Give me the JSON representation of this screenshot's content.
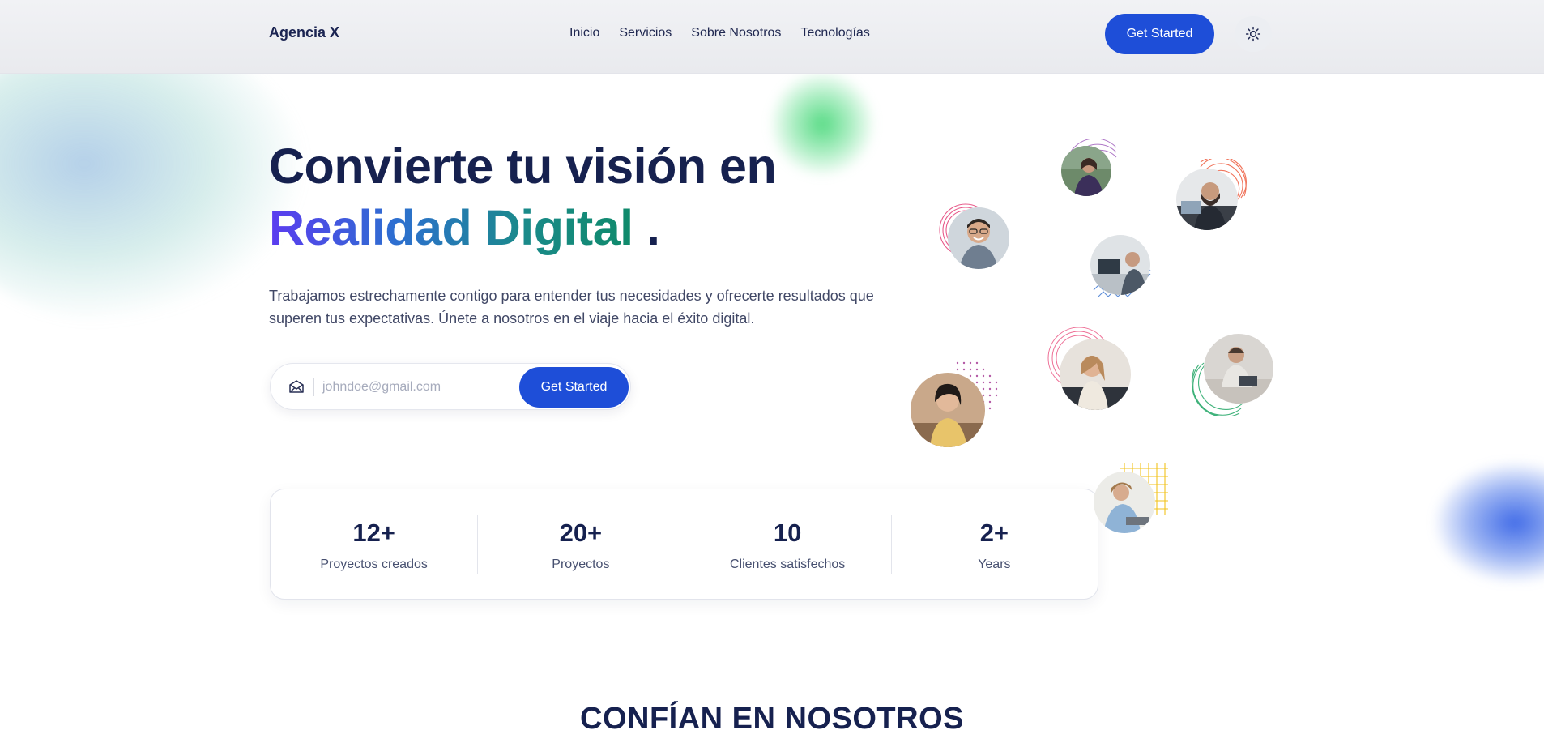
{
  "header": {
    "logo": "Agencia X",
    "nav": [
      "Inicio",
      "Servicios",
      "Sobre Nosotros",
      "Tecnologías"
    ],
    "cta_label": "Get Started",
    "theme_icon": "sun-icon"
  },
  "hero": {
    "title_line1": "Convierte tu visión en",
    "title_highlight": "Realidad Digital",
    "title_dot": ".",
    "description": "Trabajamos estrechamente contigo para entender tus necesidades y ofrecerte resultados que superen tus expectativas. Únete a nosotros en el viaje hacia el éxito digital.",
    "email_placeholder": "johndoe@gmail.com",
    "email_value": "",
    "email_button": "Get Started",
    "email_icon": "envelope-icon"
  },
  "stats": [
    {
      "value": "12+",
      "label": "Proyectos creados"
    },
    {
      "value": "20+",
      "label": "Proyectos"
    },
    {
      "value": "10",
      "label": "Clientes satisfechos"
    },
    {
      "value": "2+",
      "label": "Years"
    }
  ],
  "section_title": "CONFÍAN EN NOSOTROS",
  "colors": {
    "primary": "#1e4ed8",
    "heading": "#16214f",
    "gradient": [
      "#5b3cf0",
      "#2d6fd0",
      "#1a8a8a",
      "#0f8a6a"
    ]
  }
}
